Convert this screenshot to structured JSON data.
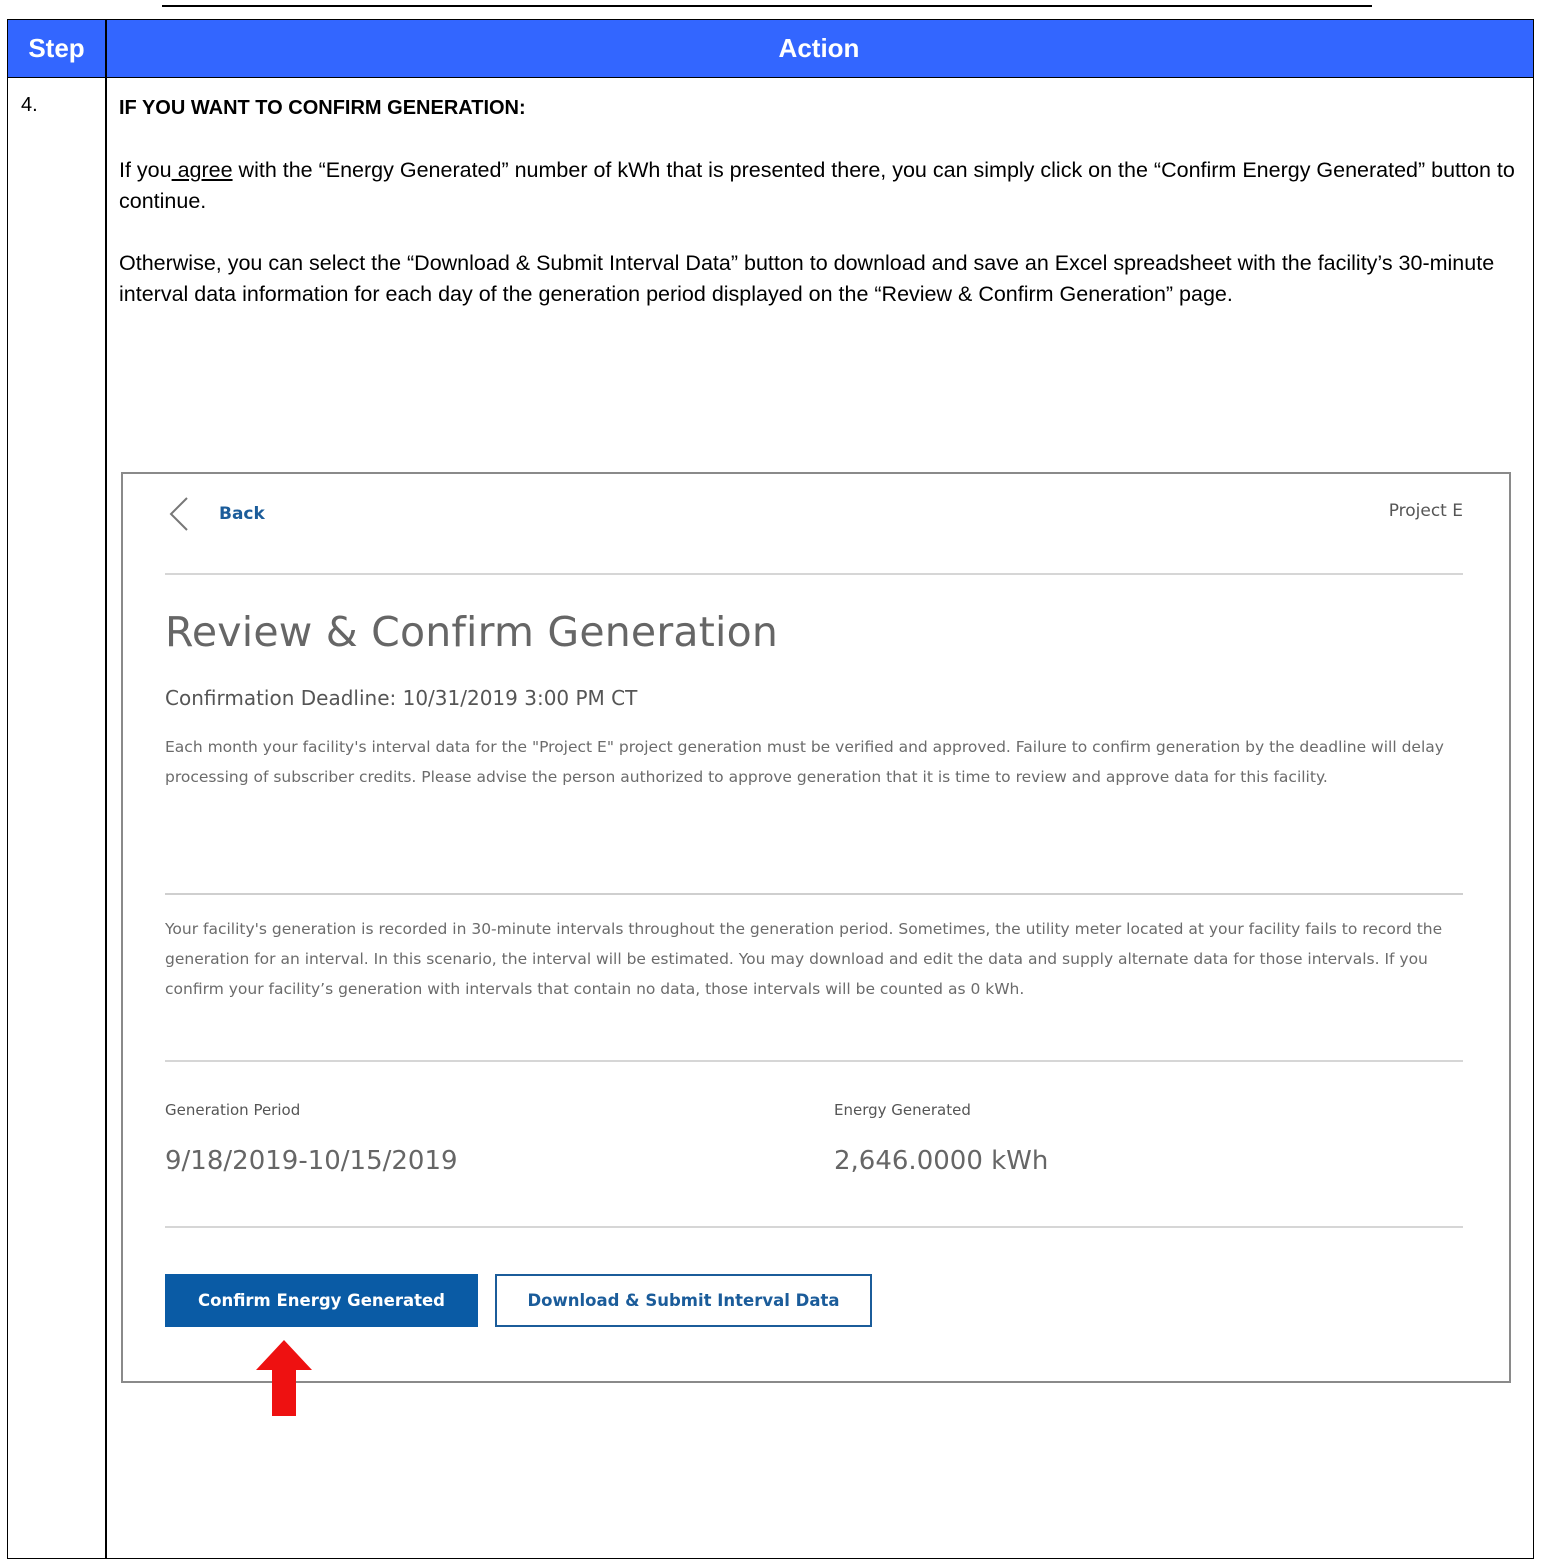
{
  "table": {
    "header_step": "Step",
    "header_action": "Action",
    "header_color": "#3366ff"
  },
  "step": {
    "number": "4.",
    "heading": "IF YOU WANT TO CONFIRM GENERATION:",
    "p1_before": "If you",
    "p1_link": " agree",
    "p1_after": " with the “Energy Generated” number of kWh that is presented there, you can simply click on the “Confirm Energy Generated” button to continue.",
    "p2": "Otherwise, you can select the “Download & Submit Interval Data” button to download and save an Excel spreadsheet with the facility’s 30-minute interval data information for each day of the generation period displayed on the “Review & Confirm Generation” page."
  },
  "screenshot": {
    "back_label": "Back",
    "project_label": "Project E",
    "title": "Review & Confirm Generation",
    "deadline": "Confirmation Deadline: 10/31/2019 3:00 PM CT",
    "para1": "Each month your facility's interval data for the \"Project E\" project generation must be verified and approved. Failure to confirm generation by the deadline will delay processing of subscriber credits. Please advise the person authorized to approve generation that it is time to review and approve data for this facility.",
    "para2": "Your facility's generation is recorded in 30-minute intervals throughout the generation period. Sometimes, the utility meter located at your facility fails to record the generation for an interval. In this scenario, the interval will be estimated. You may download and edit the data and supply alternate data for those intervals. If you confirm your facility’s generation with intervals that contain no data, those intervals will be counted as 0 kWh.",
    "period_label": "Generation Period",
    "period_value": "9/18/2019-10/15/2019",
    "energy_label": "Energy Generated",
    "energy_value": "2,646.0000 kWh",
    "confirm_button": "Confirm Energy Generated",
    "download_button": "Download & Submit Interval Data",
    "primary_color": "#0a5ba5"
  },
  "annotation": {
    "icon": "red-up-arrow-icon",
    "color": "#ee1111"
  }
}
